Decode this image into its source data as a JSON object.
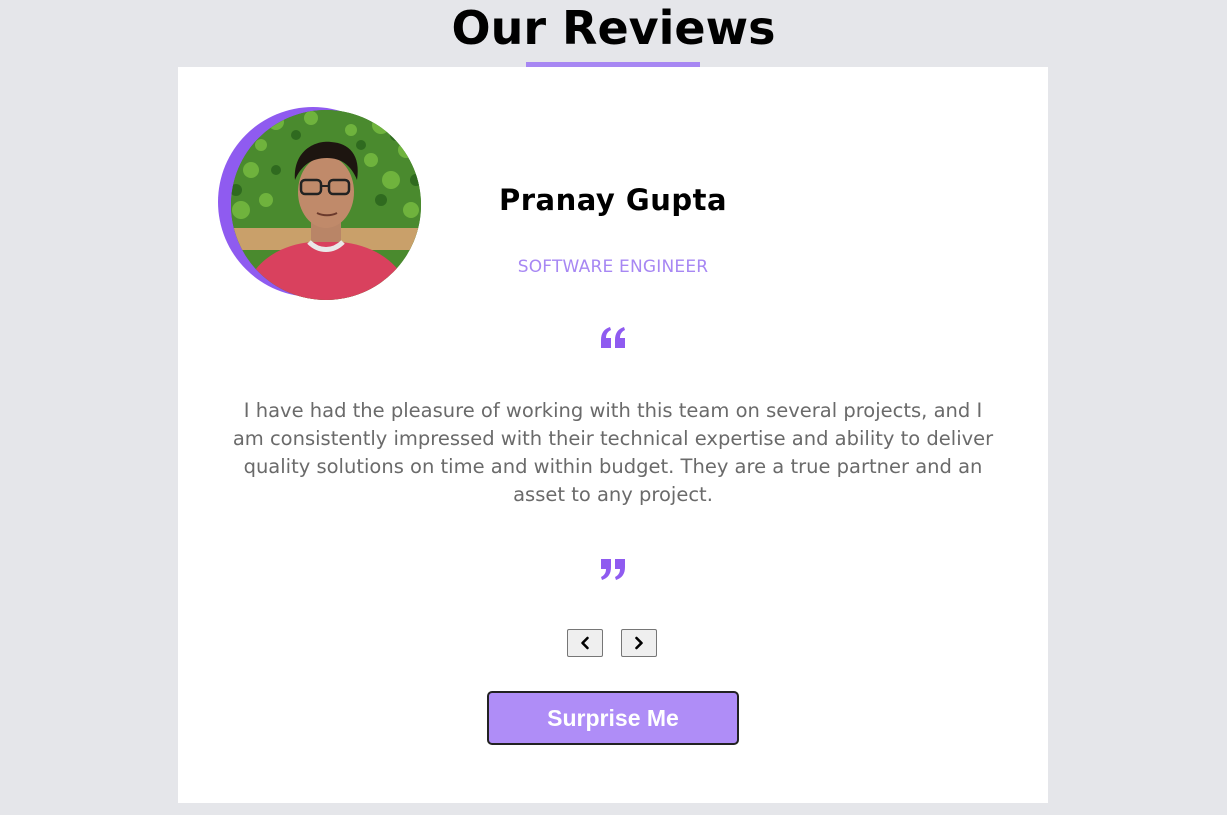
{
  "header": {
    "title": "Our Reviews"
  },
  "review": {
    "name": "Pranay Gupta",
    "job": "SOFTWARE ENGINEER",
    "text": "I have had the pleasure of working with this team on several projects, and I am consistently impressed with their technical expertise and ability to deliver quality solutions on time and within budget. They are a true partner and an asset to any project.",
    "avatar_icon": "person-photo"
  },
  "controls": {
    "prev_icon": "chevron-left-icon",
    "next_icon": "chevron-right-icon",
    "surprise_label": "Surprise Me"
  },
  "colors": {
    "accent": "#a787f3",
    "accent_dark": "#8f5bf0",
    "button_bg": "#af8df7",
    "page_bg": "#e5e6ea",
    "card_bg": "#ffffff",
    "text_gray": "#6a6a6a"
  }
}
